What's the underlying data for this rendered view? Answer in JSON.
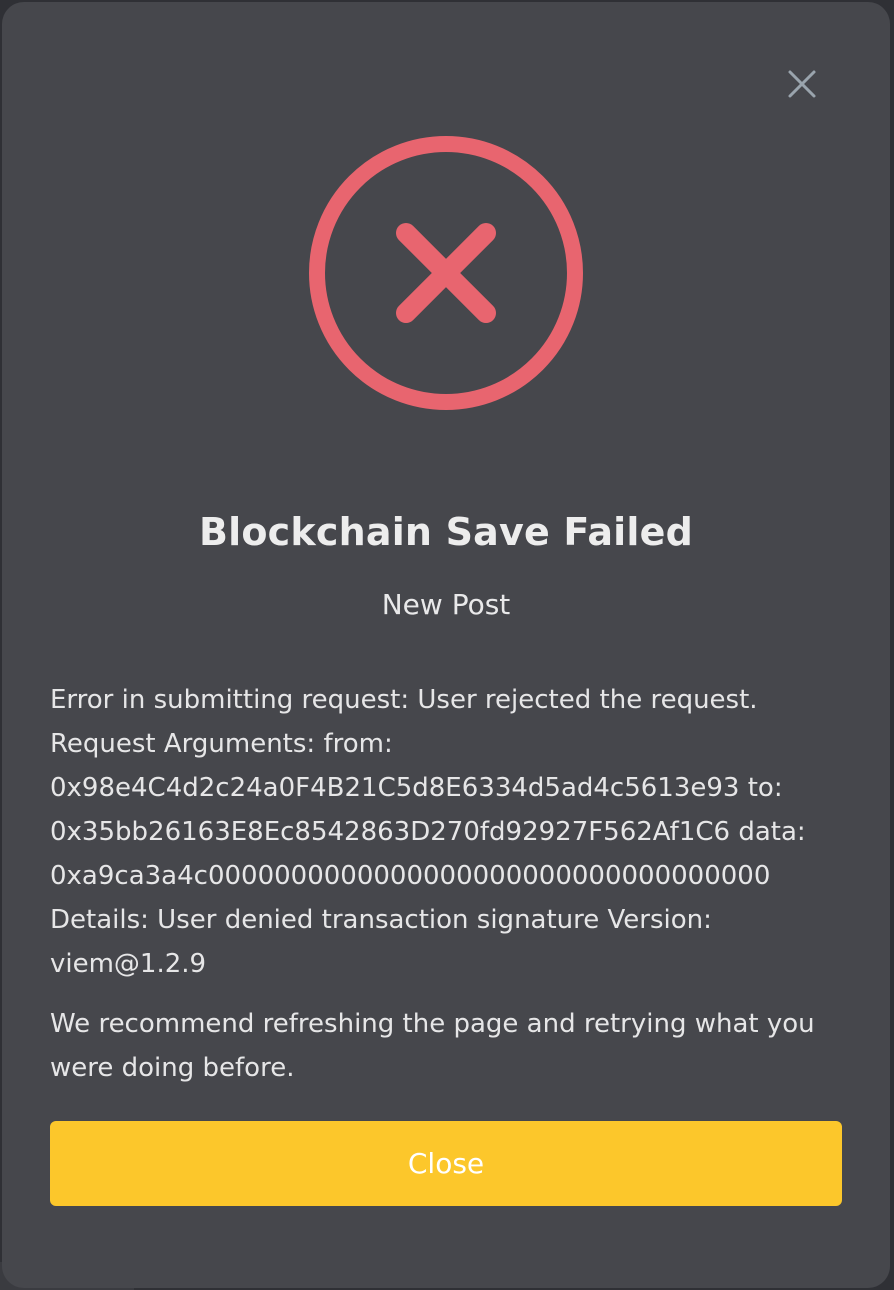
{
  "modal": {
    "close_icon": "close-icon",
    "status_icon": "error-circle-x-icon",
    "title": "Blockchain Save Failed",
    "subtitle": "New Post",
    "error_lines": [
      "Error in submitting request: User rejected the request.",
      "Request Arguments: from:",
      "0x98e4C4d2c24a0F4B21C5d8E6334d5ad4c5613e93 to:",
      "0x35bb26163E8Ec8542863D270fd92927F562Af1C6 data:",
      "0xa9ca3a4c0000000000000000000000000000000000",
      "Details: User denied transaction signature Version:",
      "viem@1.2.9"
    ],
    "recommend_lines": [
      "We recommend refreshing the page and retrying what you",
      "were doing before."
    ],
    "button_label": "Close"
  },
  "colors": {
    "modal_bg": "#46474c",
    "error_red": "#e8656f",
    "button_yellow": "#fcc72b",
    "close_icon_gray": "#9aa4ad"
  }
}
